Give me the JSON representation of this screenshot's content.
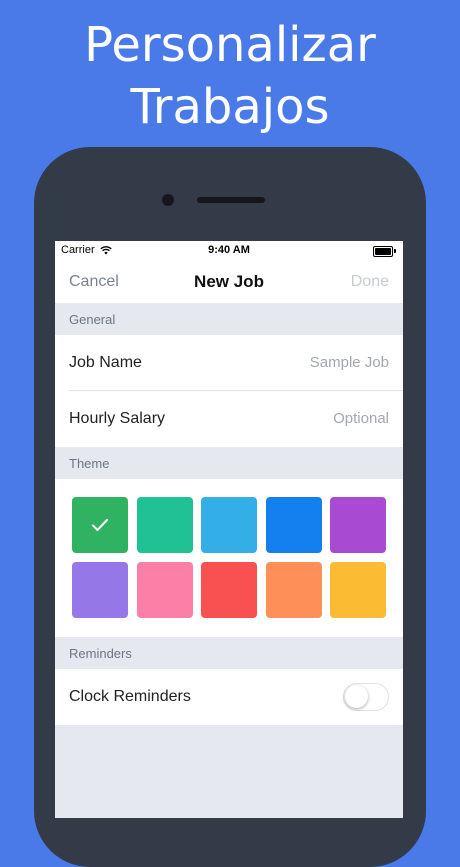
{
  "headline": {
    "line1": "Personalizar",
    "line2": "Trabajos"
  },
  "status_bar": {
    "carrier": "Carrier",
    "time": "9:40 AM"
  },
  "nav": {
    "cancel_label": "Cancel",
    "title": "New Job",
    "done_label": "Done"
  },
  "sections": {
    "general": "General",
    "theme": "Theme",
    "reminders": "Reminders"
  },
  "general": {
    "job_name_label": "Job Name",
    "job_name_placeholder": "Sample Job",
    "hourly_salary_label": "Hourly Salary",
    "hourly_salary_placeholder": "Optional"
  },
  "theme": {
    "selected_index": 0,
    "colors": [
      "#2fb362",
      "#20c293",
      "#34aee6",
      "#1480f0",
      "#a84ad2",
      "#9577e8",
      "#fc7fa8",
      "#f95151",
      "#fe8f58",
      "#fbbb33"
    ]
  },
  "reminders": {
    "clock_reminders_label": "Clock Reminders",
    "clock_reminders_on": false
  },
  "colors": {
    "background": "#4a79e8",
    "phone_frame": "#333a48",
    "group_background": "#e5e8ee"
  }
}
